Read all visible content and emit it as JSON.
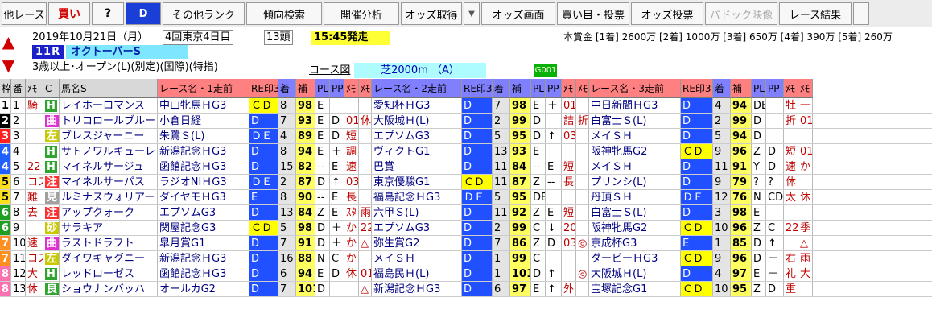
{
  "toolbar": {
    "buttons": [
      {
        "label": "他レース",
        "w": 56,
        "style": ""
      },
      {
        "label": "買い",
        "w": 52,
        "style": "red"
      },
      {
        "label": "?",
        "w": 40,
        "style": "bold"
      },
      {
        "label": "D",
        "w": 44,
        "style": "blue"
      },
      {
        "label": "その他ランク",
        "w": 102,
        "style": ""
      },
      {
        "label": "傾向検索",
        "w": 94,
        "style": ""
      },
      {
        "label": "開催分析",
        "w": 94,
        "style": ""
      },
      {
        "label": "オッズ取得",
        "w": 76,
        "style": ""
      },
      {
        "label": "▼",
        "w": 20,
        "style": "arrow"
      },
      {
        "label": "オッズ画面",
        "w": 92,
        "style": ""
      },
      {
        "label": "買い目・投票",
        "w": 90,
        "style": ""
      },
      {
        "label": "オッズ投票",
        "w": 90,
        "style": ""
      },
      {
        "label": "パドック映像",
        "w": 90,
        "style": "disabled"
      },
      {
        "label": "レース結果",
        "w": 90,
        "style": ""
      },
      {
        "label": "",
        "w": 20,
        "style": ""
      }
    ]
  },
  "race": {
    "date": "2019年10月21日（月）",
    "meeting": "4回東京4日目",
    "heads": "13頭",
    "start": "15:45発走",
    "number": "11R",
    "name": "オクトーバーS",
    "conditions": "3歳以上･オープン(L)(別定)(国際)(特指)",
    "course_link": "コース図",
    "course": "芝2000m （A）",
    "code": "G001",
    "prize": "本賞金 [1着] 2600万 [2着] 1000万 [3着] 650万 [4着] 390万 [5着] 260万"
  },
  "columns": [
    "枠",
    "番",
    "ﾒﾓ",
    "C",
    "馬名S",
    "レース名・1走前",
    "RE印3",
    "着",
    "補",
    "PL",
    "PP",
    "ﾒﾓ",
    "ﾒﾓ",
    "レース名・2走前",
    "RE印3",
    "着",
    "補",
    "PL",
    "PP",
    "ﾒﾓ",
    "ﾒﾓ",
    "レース名・3走前",
    "RE印3",
    "着",
    "補",
    "PL",
    "PP",
    "ﾒﾓ",
    "ﾒﾓ"
  ],
  "header_colors": [
    "#d8d8d8",
    "#d8d8d8",
    "#d8d8d8",
    "#d8d8d8",
    "#d8d8d8",
    "#ff8080",
    "#ff8080",
    "#8080ff",
    "#ff8080",
    "#8080ff",
    "#8080ff",
    "#ff8080",
    "#ff8080",
    "#8080ff",
    "#8080ff",
    "#8080ff",
    "#8080ff",
    "#8080ff",
    "#8080ff",
    "#ff8080",
    "#ff8080",
    "#ff8080",
    "#ff8080",
    "#8080ff",
    "#ff8080",
    "#8080ff",
    "#8080ff",
    "#ff8080",
    "#ff8080"
  ],
  "rows": [
    {
      "waku": "1",
      "wc": "#ffffff",
      "wt": "#000",
      "no": "1",
      "memo": "騎",
      "mark": "H",
      "markbg": "#2fa42f",
      "name": "レイホーロマンス",
      "r": [
        [
          "中山牝馬ＨG3",
          "ＣＤ",
          "8",
          "98",
          "E",
          "",
          "",
          ""
        ],
        [
          "愛知杯ＨG3",
          "D",
          "7",
          "98",
          "E",
          "＋",
          "01",
          ""
        ],
        [
          "中日新聞ＨG3",
          "D",
          "4",
          "94",
          "DE",
          "",
          "牡",
          "一"
        ]
      ]
    },
    {
      "waku": "2",
      "wc": "#000000",
      "wt": "#fff",
      "no": "2",
      "memo": "",
      "mark": "曲",
      "markbg": "#e030d0",
      "name": "トリコロールブルー",
      "r": [
        [
          "小倉日経",
          "D",
          "7",
          "93",
          "E",
          "D",
          "01",
          "休"
        ],
        [
          "大阪城Ｈ(L)",
          "D",
          "2",
          "99",
          "D",
          "",
          "詰",
          "折"
        ],
        [
          "白富士Ｓ(L)",
          "D",
          "2",
          "99",
          "D",
          "",
          "折",
          "01"
        ]
      ]
    },
    {
      "waku": "3",
      "wc": "#ff2020",
      "wt": "#fff",
      "no": "3",
      "memo": "",
      "mark": "左",
      "markbg": "#c8c800",
      "name": "ブレスジャーニー",
      "r": [
        [
          "朱鷺Ｓ(L)",
          "ＤＥ",
          "4",
          "89",
          "E",
          "D",
          "短",
          ""
        ],
        [
          "エプソムG3",
          "D",
          "5",
          "95",
          "D",
          "↑",
          "03",
          ""
        ],
        [
          "メイＳＨ",
          "D",
          "5",
          "94",
          "D",
          "",
          "",
          ""
        ]
      ]
    },
    {
      "waku": "4",
      "wc": "#2060ff",
      "wt": "#fff",
      "no": "4",
      "memo": "",
      "mark": "H",
      "markbg": "#2fa42f",
      "name": "サトノワルキューレ",
      "r": [
        [
          "新潟記念ＨG3",
          "D",
          "8",
          "94",
          "E",
          "＋",
          "調",
          ""
        ],
        [
          "ヴィクトG1",
          "D",
          "13",
          "93",
          "E",
          "",
          "",
          ""
        ],
        [
          "阪神牝馬G2",
          "ＣＤ",
          "9",
          "96",
          "Z",
          "D",
          "短",
          "01"
        ]
      ]
    },
    {
      "waku": "4",
      "wc": "#2060ff",
      "wt": "#fff",
      "no": "5",
      "memo": "22",
      "mark": "H",
      "markbg": "#2fa42f",
      "name": "マイネルサージュ",
      "r": [
        [
          "函館記念ＨG3",
          "D",
          "15",
          "82",
          "--",
          "E",
          "速",
          ""
        ],
        [
          "巴賞",
          "D",
          "11",
          "84",
          "--",
          "E",
          "短",
          ""
        ],
        [
          "メイＳＨ",
          "D",
          "11",
          "91",
          "Y",
          "D",
          "速",
          "か"
        ]
      ]
    },
    {
      "waku": "5",
      "wc": "#ffe020",
      "wt": "#000",
      "no": "6",
      "memo": "コス",
      "mark": "注",
      "markbg": "#ff3030",
      "name": "マイネルサーパス",
      "r": [
        [
          "ラジオNIＨG3",
          "ＤＥ",
          "2",
          "87",
          "D",
          "↑",
          "03",
          ""
        ],
        [
          "東京優駿G1",
          "ＣＤ",
          "11",
          "87",
          "Z",
          "--",
          "長",
          ""
        ],
        [
          "プリンシ(L)",
          "D",
          "9",
          "79",
          "?",
          "?",
          "休",
          ""
        ]
      ]
    },
    {
      "waku": "5",
      "wc": "#ffe020",
      "wt": "#000",
      "no": "7",
      "memo": "難",
      "mark": "見",
      "markbg": "#a0a0a0",
      "name": "ルミナスウォリアー",
      "r": [
        [
          "ダイヤモＨG3",
          "E",
          "8",
          "90",
          "--",
          "E",
          "長",
          ""
        ],
        [
          "福島記念ＨG3",
          "ＤＥ",
          "5",
          "95",
          "DE",
          "",
          "",
          ""
        ],
        [
          "丹頂ＳＨ",
          "ＤＥ",
          "12",
          "76",
          "N",
          "CD",
          "太",
          "休"
        ]
      ]
    },
    {
      "waku": "6",
      "wc": "#20a020",
      "wt": "#fff",
      "no": "8",
      "memo": "去",
      "mark": "注",
      "markbg": "#ff3030",
      "name": "アップクォーク",
      "r": [
        [
          "エプソムG3",
          "D",
          "13",
          "84",
          "Z",
          "E",
          "ｽﾀ",
          "雨"
        ],
        [
          "六甲Ｓ(L)",
          "D",
          "11",
          "92",
          "Z",
          "E",
          "短",
          ""
        ],
        [
          "白富士Ｓ(L)",
          "D",
          "3",
          "98",
          "E",
          "",
          "",
          ""
        ]
      ]
    },
    {
      "waku": "6",
      "wc": "#20a020",
      "wt": "#fff",
      "no": "9",
      "memo": "",
      "mark": "砂",
      "markbg": "#c8c800",
      "name": "サラキア",
      "r": [
        [
          "関屋記念G3",
          "ＣＤ",
          "5",
          "98",
          "D",
          "＋",
          "か",
          "22"
        ],
        [
          "エプソムG3",
          "D",
          "2",
          "99",
          "C",
          "↓",
          "20",
          ""
        ],
        [
          "阪神牝馬G2",
          "ＣＤ",
          "10",
          "96",
          "Z",
          "C",
          "22",
          "季"
        ]
      ]
    },
    {
      "waku": "7",
      "wc": "#ff9020",
      "wt": "#fff",
      "no": "10",
      "memo": "速",
      "mark": "曲",
      "markbg": "#e030d0",
      "name": "ラストドラフト",
      "r": [
        [
          "皐月賞G1",
          "D",
          "7",
          "91",
          "D",
          "＋",
          "か",
          "△"
        ],
        [
          "弥生賞G2",
          "D",
          "7",
          "86",
          "Z",
          "D",
          "03",
          "◎"
        ],
        [
          "京成杯G3",
          "E",
          "1",
          "85",
          "D",
          "↑",
          "",
          "△"
        ]
      ]
    },
    {
      "waku": "7",
      "wc": "#ff9020",
      "wt": "#fff",
      "no": "11",
      "memo": "コス",
      "mark": "左",
      "markbg": "#c8c800",
      "name": "ダイワキャグニー",
      "r": [
        [
          "新潟記念ＨG3",
          "D",
          "16",
          "88",
          "N",
          "C",
          "か",
          ""
        ],
        [
          "メイＳＨ",
          "D",
          "1",
          "99",
          "C",
          "",
          "",
          ""
        ],
        [
          "ダービーＨG3",
          "ＣＤ",
          "9",
          "96",
          "D",
          "＋",
          "右",
          "雨"
        ]
      ]
    },
    {
      "waku": "8",
      "wc": "#ff70b0",
      "wt": "#fff",
      "no": "12",
      "memo": "大",
      "mark": "H",
      "markbg": "#2fa42f",
      "name": "レッドローゼス",
      "r": [
        [
          "函館記念ＨG3",
          "D",
          "6",
          "94",
          "E",
          "D",
          "休",
          "01"
        ],
        [
          "福島民Ｈ(L)",
          "D",
          "1",
          "101",
          "D",
          "↑",
          "",
          "◎"
        ],
        [
          "大阪城Ｈ(L)",
          "D",
          "4",
          "97",
          "E",
          "＋",
          "礼",
          "大"
        ]
      ]
    },
    {
      "waku": "8",
      "wc": "#ff70b0",
      "wt": "#fff",
      "no": "13",
      "memo": "休",
      "mark": "良",
      "markbg": "#2fa42f",
      "name": "ショウナンバッハ",
      "r": [
        [
          "オールカG2",
          "D",
          "7",
          "101",
          "D",
          "",
          "",
          "△"
        ],
        [
          "新潟記念ＨG3",
          "D",
          "6",
          "97",
          "E",
          "↑",
          "外",
          ""
        ],
        [
          "宝塚記念G1",
          "ＣＤ",
          "10",
          "95",
          "Z",
          "D",
          "重",
          ""
        ]
      ]
    }
  ]
}
